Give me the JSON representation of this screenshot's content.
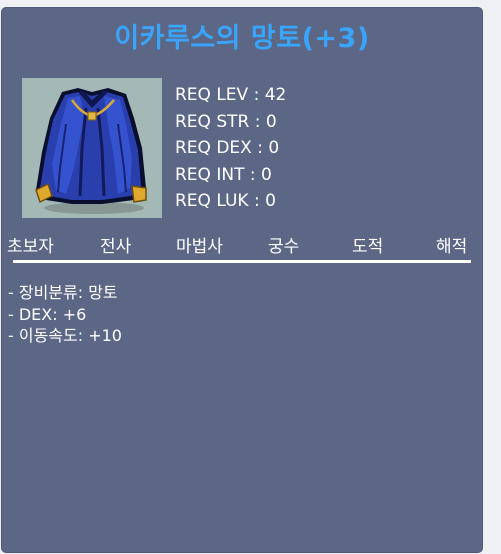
{
  "item": {
    "name": "이카루스의 망토(+3)",
    "icon": "cloak-icon"
  },
  "requirements": [
    "REQ LEV : 42",
    "REQ STR : 0",
    "REQ DEX : 0",
    "REQ INT : 0",
    "REQ LUK : 0"
  ],
  "classes": [
    "초보자",
    "전사",
    "마법사",
    "궁수",
    "도적",
    "해적"
  ],
  "stats": [
    "- 장비분류: 망토",
    "- DEX: +6",
    "- 이동속도: +10"
  ],
  "colors": {
    "card_background": "#5b6785",
    "title": "#3aa5ff",
    "text": "#ffffff",
    "icon_background": "#a4b8b6"
  }
}
